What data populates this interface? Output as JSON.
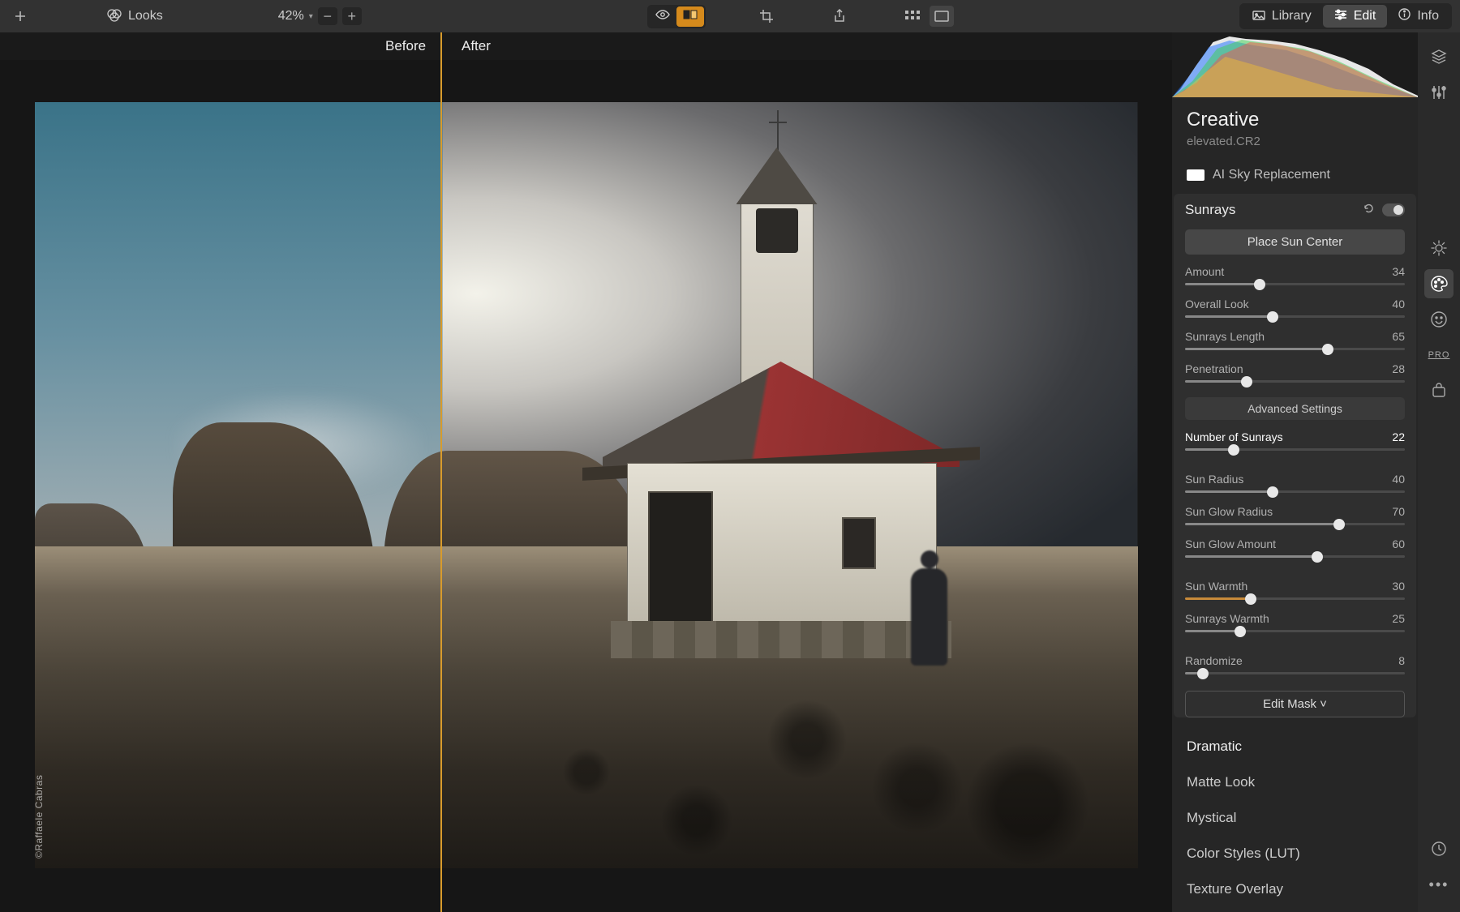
{
  "toolbar": {
    "looks": "Looks",
    "zoom": "42%"
  },
  "tabs": {
    "library": "Library",
    "edit": "Edit",
    "info": "Info"
  },
  "compare": {
    "before": "Before",
    "after": "After"
  },
  "panel": {
    "section": "Creative",
    "filename": "elevated.CR2",
    "ai_sky": "AI Sky Replacement",
    "sunrays": {
      "title": "Sunrays",
      "place": "Place Sun Center",
      "advanced": "Advanced Settings",
      "edit_mask": "Edit Mask ˅",
      "sliders": {
        "amount": {
          "label": "Amount",
          "value": 34,
          "max": 100
        },
        "overall": {
          "label": "Overall Look",
          "value": 40,
          "max": 100
        },
        "length": {
          "label": "Sunrays Length",
          "value": 65,
          "max": 100
        },
        "penetration": {
          "label": "Penetration",
          "value": 28,
          "max": 100
        },
        "num": {
          "label": "Number of Sunrays",
          "value": 22,
          "max": 100
        },
        "radius": {
          "label": "Sun Radius",
          "value": 40,
          "max": 100
        },
        "glow_radius": {
          "label": "Sun Glow Radius",
          "value": 70,
          "max": 100
        },
        "glow_amount": {
          "label": "Sun Glow Amount",
          "value": 60,
          "max": 100
        },
        "warmth": {
          "label": "Sun Warmth",
          "value": 30,
          "max": 100
        },
        "ray_warmth": {
          "label": "Sunrays Warmth",
          "value": 25,
          "max": 100
        },
        "randomize": {
          "label": "Randomize",
          "value": 8,
          "max": 100
        }
      }
    },
    "filters": {
      "dramatic": "Dramatic",
      "matte": "Matte Look",
      "mystical": "Mystical",
      "lut": "Color Styles (LUT)",
      "texture": "Texture Overlay"
    }
  },
  "credit": "©Raffaele Cabras",
  "colors": {
    "accent": "#d58a1c",
    "track_fill": "#888",
    "track_bg": "#4a4a4a",
    "warmth_fill": "#c78a3a"
  }
}
